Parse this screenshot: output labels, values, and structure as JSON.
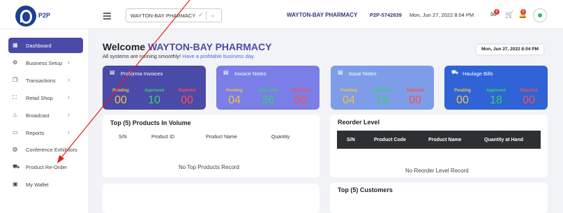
{
  "header": {
    "logo_text": "P2P",
    "store_select_value": "WAYTON-BAY PHARMACY",
    "store_name": "WAYTON-BAY PHARMACY",
    "store_code": "P2P-5742839",
    "datetime": "Mon, Jun 27, 2022 8:04 PM",
    "notifications_badge": "0",
    "alerts_badge": "0"
  },
  "sidebar": {
    "items": [
      {
        "label": "Dashboard",
        "icon": "grid-icon",
        "has_arrow": false,
        "active": true
      },
      {
        "label": "Business Setup",
        "icon": "gear-icon",
        "has_arrow": true
      },
      {
        "label": "Transactions",
        "icon": "copy-icon",
        "has_arrow": true
      },
      {
        "label": "Retail Shop",
        "icon": "scan-icon",
        "has_arrow": true
      },
      {
        "label": "Broadcast",
        "icon": "megaphone-icon",
        "has_arrow": true
      },
      {
        "label": "Reports",
        "icon": "folder-icon",
        "has_arrow": true
      },
      {
        "label": "Conference Exhibitors",
        "icon": "globe-icon",
        "has_arrow": false
      },
      {
        "label": "Product Re-Order",
        "icon": "cart-icon",
        "has_arrow": false
      },
      {
        "label": "My Wallet",
        "icon": "wallet-icon",
        "has_arrow": false
      }
    ]
  },
  "main": {
    "welcome_prefix": "Welcome",
    "welcome_name": "WAYTON-BAY PHARMACY",
    "subtitle_plain": "All systems are running smoothly!",
    "subtitle_link": "Have a profitable business day.",
    "date_chip": "Mon, Jun 27, 2022 8:04 PM",
    "cards": [
      {
        "title": "Proforma Invoices",
        "color": "#4a4aa8",
        "pending": "00",
        "approved": "10",
        "rejected": "00"
      },
      {
        "title": "Invoice Notes",
        "color": "#7b7ee6",
        "pending": "04",
        "approved": "26",
        "rejected": "00"
      },
      {
        "title": "Issue Notes",
        "color": "#7e9de8",
        "pending": "04",
        "approved": "19",
        "rejected": "00"
      },
      {
        "title": "Haulage Bills",
        "color": "#2f63d6",
        "pending": "00",
        "approved": "18",
        "rejected": "00"
      }
    ],
    "stat_labels": {
      "pending": "Pending",
      "approved": "Approved",
      "rejected": "Rejected"
    },
    "stat_colors": {
      "pending": "#f2c14e",
      "approved": "#34d36b",
      "rejected": "#ff4d4d"
    },
    "top_products": {
      "title": "Top (5) Products In Volume",
      "columns": [
        "S/N",
        "Product ID",
        "Product Name",
        "Quantity"
      ],
      "empty": "No Top Products Record"
    },
    "reorder": {
      "title": "Reorder Level",
      "columns": [
        "S/N",
        "Product Code",
        "Product Name",
        "Quantity at Hand"
      ],
      "empty": "No Reorder Level Record"
    },
    "customers": {
      "title": "Top (5) Customers"
    }
  }
}
